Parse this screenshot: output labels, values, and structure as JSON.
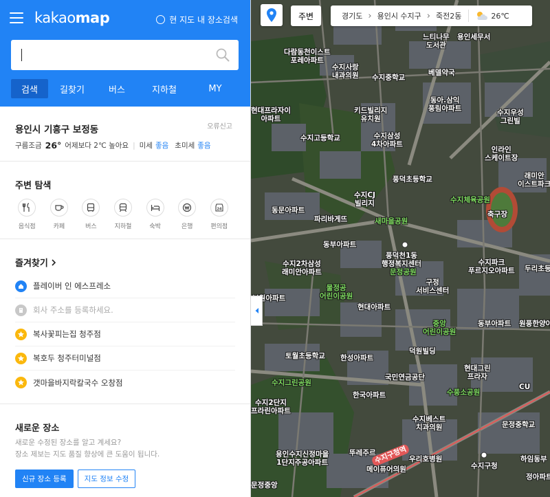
{
  "header": {
    "logo_light": "kakao",
    "logo_bold": "map",
    "in_map_search_label": "현 지도 내 장소검색",
    "search_placeholder": "",
    "tabs": [
      "검색",
      "길찾기",
      "버스",
      "지하철",
      "MY"
    ]
  },
  "weather": {
    "location": "용인시 기흥구 보정동",
    "report": "오류신고",
    "condition": "구름조금",
    "temperature": "26°",
    "compare": "어제보다 2℃ 높아요",
    "fine_dust_label": "미세",
    "fine_dust_value": "좋음",
    "ultra_fine_dust_label": "초미세",
    "ultra_fine_dust_value": "좋음"
  },
  "explore": {
    "title": "주변 탐색",
    "categories": [
      {
        "label": "음식점",
        "icon": "restaurant-icon"
      },
      {
        "label": "카페",
        "icon": "cafe-icon"
      },
      {
        "label": "버스",
        "icon": "bus-icon"
      },
      {
        "label": "지하철",
        "icon": "subway-icon"
      },
      {
        "label": "숙박",
        "icon": "lodging-icon"
      },
      {
        "label": "은행",
        "icon": "bank-icon"
      },
      {
        "label": "편의점",
        "icon": "convenience-store-icon"
      }
    ]
  },
  "favorites": {
    "title": "즐겨찾기",
    "items": [
      {
        "label": "플레이버 인 에스프레소",
        "type": "home"
      },
      {
        "label": "회사 주소를 등록하세요.",
        "type": "work"
      },
      {
        "label": "복사꽃피는집 청주점",
        "type": "star"
      },
      {
        "label": "복호두 청주터미널점",
        "type": "star"
      },
      {
        "label": "갯마을바지락칼국수 오창점",
        "type": "star"
      }
    ]
  },
  "new_place": {
    "title": "새로운 장소",
    "desc1": "새로운 수정된 장소를 알고 계세요?",
    "desc2": "장소 제보는 지도 품질 향상에 큰 도움이 됩니다.",
    "register_button": "신규 장소 등록",
    "edit_button": "지도 정보 수정"
  },
  "map_controls": {
    "near_button": "주변",
    "breadcrumb": [
      "경기도",
      "용인시 수지구",
      "죽전2동"
    ],
    "temperature": "26℃"
  },
  "map_labels": [
    {
      "text": "다람동천이스트\n포레아파트",
      "style": "white"
    },
    {
      "text": "느티나무\n도서관",
      "style": "white"
    },
    {
      "text": "용인세무서",
      "style": "white"
    },
    {
      "text": "수지사랑\n내과의원",
      "style": "white"
    },
    {
      "text": "수지중학교",
      "style": "white"
    },
    {
      "text": "베델약국",
      "style": "white"
    },
    {
      "text": "동아.삼익\n풍림아파트",
      "style": "white"
    },
    {
      "text": "현대프라자이\n아파트",
      "style": "white"
    },
    {
      "text": "키드빌리지\n유치원",
      "style": "white"
    },
    {
      "text": "수지우성\n그린빌",
      "style": "white"
    },
    {
      "text": "수지삼성\n4차아파트",
      "style": "white"
    },
    {
      "text": "수지고등학교",
      "style": "white"
    },
    {
      "text": "인라인\n스케이트장",
      "style": "white"
    },
    {
      "text": "풍덕초등학교",
      "style": "white"
    },
    {
      "text": "래미안\n이스트파크",
      "style": "white"
    },
    {
      "text": "수지CJ\n빌리지",
      "style": "white"
    },
    {
      "text": "수지체육공원",
      "style": "green"
    },
    {
      "text": "동문아파트",
      "style": "white"
    },
    {
      "text": "축구장",
      "style": "white"
    },
    {
      "text": "파리바게뜨",
      "style": "white"
    },
    {
      "text": "새마을공원",
      "style": "green"
    },
    {
      "text": "동부아파트",
      "style": "white"
    },
    {
      "text": "풍덕천1동\n행정복지센터",
      "style": "white"
    },
    {
      "text": "수지2차삼성\n래미안아파트",
      "style": "white"
    },
    {
      "text": "수지파크\n푸르지오아파트",
      "style": "white"
    },
    {
      "text": "두리초등",
      "style": "white"
    },
    {
      "text": "문정공원",
      "style": "green"
    },
    {
      "text": "구정\n서비스센터",
      "style": "white"
    },
    {
      "text": "보원아파트",
      "style": "white"
    },
    {
      "text": "물정공\n어린이공원",
      "style": "green"
    },
    {
      "text": "현대아파트",
      "style": "white"
    },
    {
      "text": "중앙\n어린이공원",
      "style": "green"
    },
    {
      "text": "동부아파트",
      "style": "white"
    },
    {
      "text": "원풍한양아파트",
      "style": "white"
    },
    {
      "text": "토월초등학교",
      "style": "white"
    },
    {
      "text": "한성아파트",
      "style": "white"
    },
    {
      "text": "덕원빌딩",
      "style": "white"
    },
    {
      "text": "현대그린\n프라자",
      "style": "white"
    },
    {
      "text": "국민연금공단",
      "style": "white"
    },
    {
      "text": "수지그린공원",
      "style": "green"
    },
    {
      "text": "수풍소공원",
      "style": "green"
    },
    {
      "text": "CU",
      "style": "white"
    },
    {
      "text": "한국아파트",
      "style": "white"
    },
    {
      "text": "수지2단지\n프라린아파트",
      "style": "white"
    },
    {
      "text": "수지베스트\n치과의원",
      "style": "white"
    },
    {
      "text": "문정중학교",
      "style": "white"
    },
    {
      "text": "용인수지신정마을\n1단지주공아파트",
      "style": "white"
    },
    {
      "text": "뚜레주르",
      "style": "white"
    },
    {
      "text": "우리호병원",
      "style": "white"
    },
    {
      "text": "메이퓨어의원",
      "style": "white"
    },
    {
      "text": "수지구청",
      "style": "white"
    },
    {
      "text": "하임동부",
      "style": "white"
    },
    {
      "text": "수지구청역",
      "style": "white"
    },
    {
      "text": "정아파트",
      "style": "white"
    },
    {
      "text": "문정중앙",
      "style": "white"
    }
  ]
}
